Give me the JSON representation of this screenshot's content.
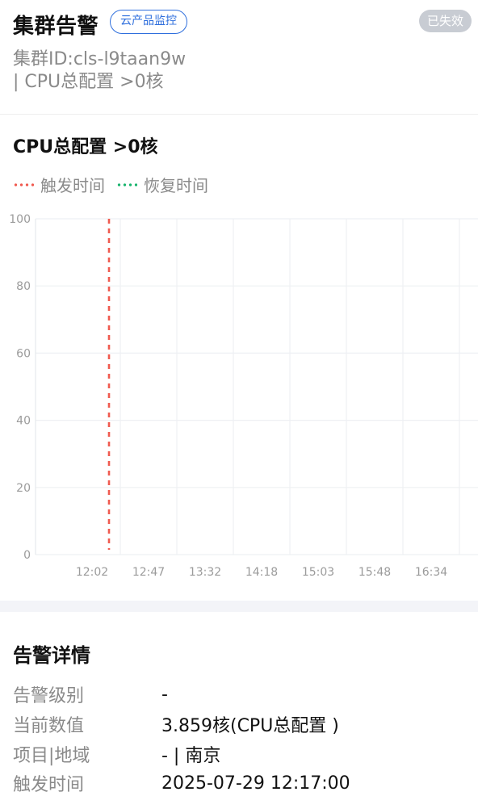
{
  "header": {
    "title": "集群告警",
    "tag": "云产品监控",
    "status": "已失效",
    "meta_line1": "集群ID:cls-l9taan9w",
    "meta_line2": "| CPU总配置 >0核"
  },
  "chart": {
    "title": "CPU总配置 >0核",
    "legend": [
      {
        "label": "触发时间",
        "color": "#f05a4f"
      },
      {
        "label": "恢复时间",
        "color": "#19b46e"
      }
    ]
  },
  "chart_data": {
    "type": "line",
    "categories": [
      "12:02",
      "12:47",
      "13:32",
      "14:18",
      "15:03",
      "15:48",
      "16:34"
    ],
    "y_ticks": [
      0,
      20,
      40,
      60,
      80,
      100
    ],
    "ylim": [
      0,
      100
    ],
    "series": [],
    "markers": [
      {
        "legend": "触发时间",
        "position_between_categories": [
          0,
          1
        ],
        "fraction": 0.3
      }
    ]
  },
  "details": {
    "title": "告警详情",
    "rows": [
      {
        "label": "告警级别",
        "value": "-"
      },
      {
        "label": "当前数值",
        "value": "3.859核(CPU总配置 )"
      },
      {
        "label": "项目|地域",
        "value": "- | 南京"
      },
      {
        "label": "触发时间",
        "value": "2025-07-29 12:17:00"
      }
    ]
  }
}
